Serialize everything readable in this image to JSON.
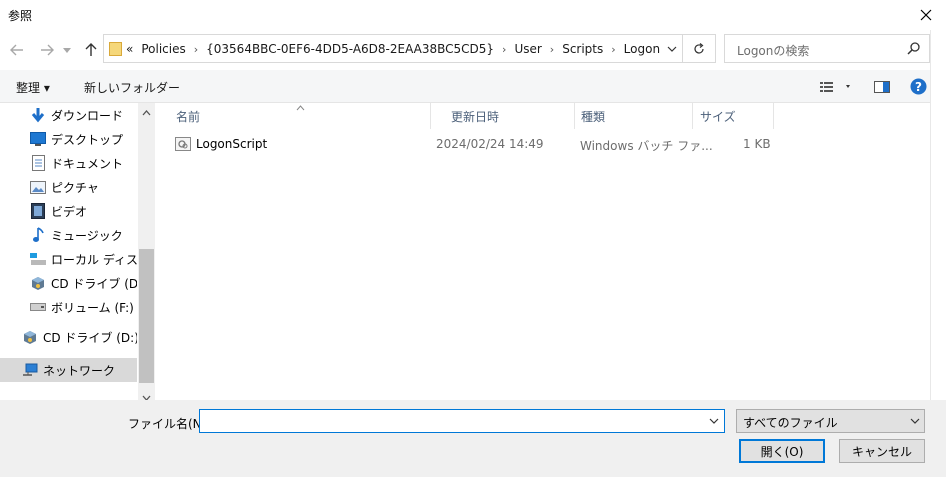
{
  "window": {
    "title": "参照"
  },
  "address": {
    "overflow": "«",
    "crumbs": [
      "Policies",
      "{03564BBC-0EF6-4DD5-A6D8-2EAA38BC5CD5}",
      "User",
      "Scripts",
      "Logon"
    ]
  },
  "search": {
    "placeholder": "Logonの検索"
  },
  "toolbar": {
    "organize_label": "整理 ▾",
    "new_folder_label": "新しいフォルダー"
  },
  "sidebar": {
    "items": [
      {
        "label": "ダウンロード",
        "icon": "download-arrow-icon"
      },
      {
        "label": "デスクトップ",
        "icon": "desktop-icon"
      },
      {
        "label": "ドキュメント",
        "icon": "document-icon"
      },
      {
        "label": "ピクチャ",
        "icon": "picture-icon"
      },
      {
        "label": "ビデオ",
        "icon": "video-icon"
      },
      {
        "label": "ミュージック",
        "icon": "music-note-icon"
      },
      {
        "label": "ローカル ディスク (C",
        "icon": "local-disk-icon"
      },
      {
        "label": "CD ドライブ (D:) Vi",
        "icon": "cd-drive-icon"
      },
      {
        "label": "ボリューム (F:)",
        "icon": "volume-drive-icon"
      },
      {
        "label": "CD ドライブ (D:) Virt",
        "icon": "cd-drive-icon"
      },
      {
        "label": "ネットワーク",
        "icon": "network-icon"
      }
    ]
  },
  "columns": [
    "名前",
    "更新日時",
    "種類",
    "サイズ"
  ],
  "files": [
    {
      "name": "LogonScript",
      "modified": "2024/02/24 14:49",
      "type": "Windows バッチ ファ...",
      "size": "1 KB",
      "icon": "batch-file-icon"
    }
  ],
  "bottom": {
    "filename_label": "ファイル名(N):",
    "filename_value": "",
    "filter_value": "すべてのファイル",
    "open_label": "開く(O)",
    "cancel_label": "キャンセル"
  },
  "colors": {
    "accent": "#0078d7",
    "help": "#1e6fc9",
    "folder": "#f5c542"
  }
}
